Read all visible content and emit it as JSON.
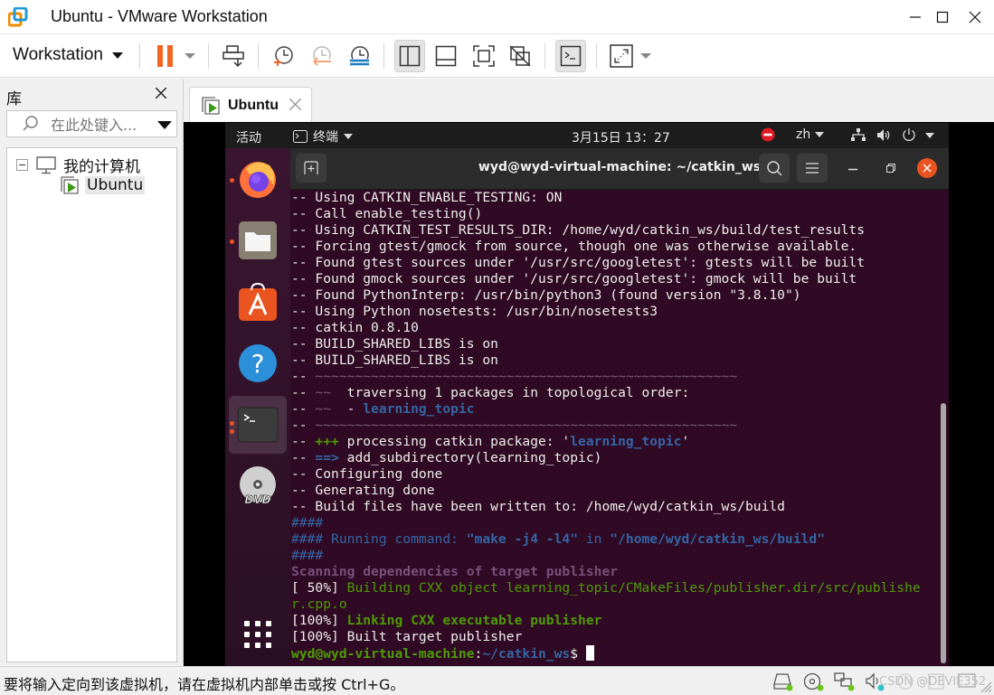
{
  "window": {
    "title": "Ubuntu - VMware Workstation",
    "controls": [
      "minimize",
      "maximize",
      "close"
    ]
  },
  "toolbar": {
    "workstation_label": "Workstation",
    "buttons": [
      "pause-icon",
      "send-ctrl-alt-del-icon",
      "snapshot-take-icon",
      "snapshot-revert-icon",
      "snapshot-manager-icon",
      "show-library-icon",
      "thumbnail-bar-icon",
      "full-screen-icon",
      "unity-icon",
      "console-view-icon",
      "stretch-guest-icon"
    ]
  },
  "library": {
    "title": "库",
    "search_placeholder": "在此处键入...",
    "tree": {
      "root_label": "我的计算机",
      "vm_label": "Ubuntu"
    }
  },
  "tab": {
    "label": "Ubuntu"
  },
  "gnome": {
    "activities": "活动",
    "app_menu": "终端",
    "clock": "3月15日  13：27",
    "input_method": "zh"
  },
  "terminal": {
    "title": "wyd@wyd-virtual-machine: ~/catkin_ws",
    "lines": [
      {
        "parts": [
          {
            "t": "-- Using CATKIN_ENABLE_TESTING: ON",
            "c": ""
          }
        ]
      },
      {
        "parts": [
          {
            "t": "-- Call enable_testing()",
            "c": ""
          }
        ]
      },
      {
        "parts": [
          {
            "t": "-- Using CATKIN_TEST_RESULTS_DIR: /home/wyd/catkin_ws/build/test_results",
            "c": ""
          }
        ]
      },
      {
        "parts": [
          {
            "t": "-- Forcing gtest/gmock from source, though one was otherwise available.",
            "c": ""
          }
        ]
      },
      {
        "parts": [
          {
            "t": "-- Found gtest sources under '/usr/src/googletest': gtests will be built",
            "c": ""
          }
        ]
      },
      {
        "parts": [
          {
            "t": "-- Found gmock sources under '/usr/src/googletest': gmock will be built",
            "c": ""
          }
        ]
      },
      {
        "parts": [
          {
            "t": "-- Found PythonInterp: /usr/bin/python3 (found version \"3.8.10\")",
            "c": ""
          }
        ]
      },
      {
        "parts": [
          {
            "t": "-- Using Python nosetests: /usr/bin/nosetests3",
            "c": ""
          }
        ]
      },
      {
        "parts": [
          {
            "t": "-- catkin 0.8.10",
            "c": ""
          }
        ]
      },
      {
        "parts": [
          {
            "t": "-- BUILD_SHARED_LIBS is on",
            "c": ""
          }
        ]
      },
      {
        "parts": [
          {
            "t": "-- BUILD_SHARED_LIBS is on",
            "c": ""
          }
        ]
      },
      {
        "parts": [
          {
            "t": "-- ",
            "c": ""
          },
          {
            "t": "~~~~~~~~~~~~~~~~~~~~~~~~~~~~~~~~~~~~~~~~~~~~~~~~~~~~~",
            "c": "c-dim"
          }
        ]
      },
      {
        "parts": [
          {
            "t": "-- ",
            "c": ""
          },
          {
            "t": "~~",
            "c": "c-dim"
          },
          {
            "t": "  traversing 1 packages in topological order:",
            "c": ""
          }
        ]
      },
      {
        "parts": [
          {
            "t": "-- ",
            "c": ""
          },
          {
            "t": "~~",
            "c": "c-dim"
          },
          {
            "t": "  - ",
            "c": ""
          },
          {
            "t": "learning_topic",
            "c": "c-blueb"
          }
        ]
      },
      {
        "parts": [
          {
            "t": "-- ",
            "c": ""
          },
          {
            "t": "~~~~~~~~~~~~~~~~~~~~~~~~~~~~~~~~~~~~~~~~~~~~~~~~~~~~~",
            "c": "c-dim"
          }
        ]
      },
      {
        "parts": [
          {
            "t": "-- ",
            "c": ""
          },
          {
            "t": "+++",
            "c": "c-greenb"
          },
          {
            "t": " processing catkin package: '",
            "c": ""
          },
          {
            "t": "learning_topic",
            "c": "c-blueb"
          },
          {
            "t": "'",
            "c": ""
          }
        ]
      },
      {
        "parts": [
          {
            "t": "-- ",
            "c": ""
          },
          {
            "t": "==>",
            "c": "c-blueb"
          },
          {
            "t": " add_subdirectory(learning_topic)",
            "c": ""
          }
        ]
      },
      {
        "parts": [
          {
            "t": "-- Configuring done",
            "c": ""
          }
        ]
      },
      {
        "parts": [
          {
            "t": "-- Generating done",
            "c": ""
          }
        ]
      },
      {
        "parts": [
          {
            "t": "-- Build files have been written to: /home/wyd/catkin_ws/build",
            "c": ""
          }
        ]
      },
      {
        "parts": [
          {
            "t": "####",
            "c": "c-blue"
          }
        ]
      },
      {
        "parts": [
          {
            "t": "#### Running command: ",
            "c": "c-blue"
          },
          {
            "t": "\"make -j4 -l4\"",
            "c": "c-blueb"
          },
          {
            "t": " in ",
            "c": "c-blue"
          },
          {
            "t": "\"/home/wyd/catkin_ws/build\"",
            "c": "c-blueb"
          }
        ]
      },
      {
        "parts": [
          {
            "t": "####",
            "c": "c-blue"
          }
        ]
      },
      {
        "parts": [
          {
            "t": "Scanning dependencies of target publisher",
            "c": "c-purple"
          }
        ]
      },
      {
        "parts": [
          {
            "t": "[ 50%] ",
            "c": ""
          },
          {
            "t": "Building CXX object learning_topic/CMakeFiles/publisher.dir/src/publishe",
            "c": "c-green"
          }
        ]
      },
      {
        "parts": [
          {
            "t": "r.cpp.o",
            "c": "c-green"
          }
        ]
      },
      {
        "parts": [
          {
            "t": "[100%] ",
            "c": ""
          },
          {
            "t": "Linking CXX executable publisher",
            "c": "c-greenb"
          }
        ]
      },
      {
        "parts": [
          {
            "t": "[100%] Built target publisher",
            "c": ""
          }
        ]
      }
    ],
    "prompt": {
      "user_host": "wyd@wyd-virtual-machine",
      "sep": ":",
      "path": "~/catkin_ws",
      "symbol": "$ "
    }
  },
  "dock": {
    "items": [
      "firefox-icon",
      "files-icon",
      "software-icon",
      "help-icon",
      "terminal-icon",
      "dvd-icon",
      "show-apps-icon"
    ]
  },
  "statusbar": {
    "message": "要将输入定向到该虚拟机，请在虚拟机内部单击或按 Ctrl+G。",
    "watermark": "CSDN @DEVIE352"
  },
  "colors": {
    "terminal_bg": "#300a24",
    "ubuntu_orange": "#e95420",
    "vmware_orange": "#f26522"
  }
}
